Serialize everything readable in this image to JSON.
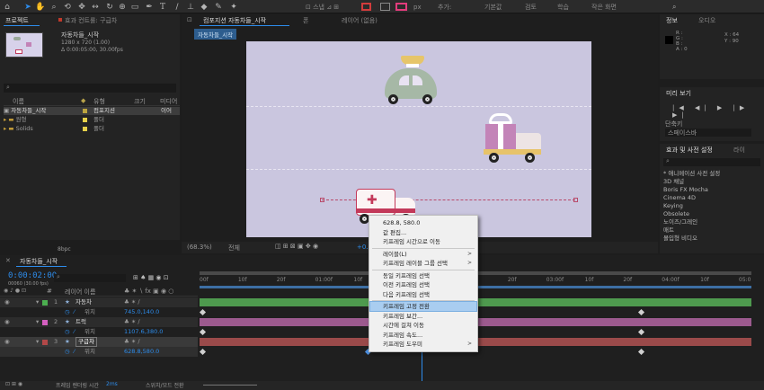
{
  "toolbar": {
    "default_label": "기본값",
    "review_label": "검토",
    "learn_label": "학습",
    "small_screen_label": "작은 화면",
    "add_label": "추가:",
    "fill_label": "칠",
    "px_label": "px"
  },
  "project_panel": {
    "tab_project": "프로젝트",
    "tab_effect_controls": "효과 컨트롤: 구급차",
    "comp_name": "자동차들_시작",
    "comp_size": "1280 x 720 (1.00)",
    "comp_duration": "Δ 0:00:05:00, 30.00fps",
    "col_name": "이름",
    "col_type": "유형",
    "col_size": "크기",
    "col_media": "미디어",
    "items": [
      {
        "name": "자동차들_시작",
        "type": "컴포지션",
        "extra": "이어"
      },
      {
        "name": "원형",
        "type": "폴더",
        "extra": ""
      },
      {
        "name": "Solids",
        "type": "폴더",
        "extra": ""
      }
    ],
    "bpc": "8bpc"
  },
  "comp_panel": {
    "tab_comp": "컴포지션 자동차들_시작",
    "tab_layer": "레이어 (없음)",
    "tab_ext": "폰",
    "breadcrumb": "자동차들_시작",
    "zoom": "(68.3%)",
    "quality": "전체",
    "exposure": "+0.0"
  },
  "info_panel": {
    "tab_info": "정보",
    "tab_audio": "오디오",
    "rgb": [
      "R :",
      "G :",
      "B :",
      "A : 0"
    ],
    "x": "X : 64",
    "y": "Y : 90"
  },
  "preview_panel": {
    "title": "미리 보기",
    "shortcut_label": "단축키",
    "shortcut_value": "스페이스바"
  },
  "effects_panel": {
    "title": "효과 및 사전 설정",
    "tab_lib": "라이",
    "items": [
      "* 애니메이션 사전 설정",
      "3D 채널",
      "Boris FX Mocha",
      "Cinema 4D",
      "Keying",
      "Obsolete",
      "노이즈/그레인",
      "매트",
      "몰입형 비디오"
    ]
  },
  "context_menu": {
    "items": [
      {
        "label": "628.8, 580.0",
        "arrow": ""
      },
      {
        "label": "값 편집...",
        "arrow": ""
      },
      {
        "label": "키프레임 시간으로 이동",
        "arrow": ""
      },
      {
        "label": "레이블(L)",
        "arrow": ">"
      },
      {
        "label": "키프레임 레이블 그룹 선택",
        "arrow": ">"
      },
      {
        "label": "동일 키프레임 선택",
        "arrow": ""
      },
      {
        "label": "이전 키프레임 선택",
        "arrow": ""
      },
      {
        "label": "다음 키프레임 선택",
        "arrow": ""
      },
      {
        "label": "키프레임 고정 전환",
        "arrow": ""
      },
      {
        "label": "키프레임 보간...",
        "arrow": ""
      },
      {
        "label": "시간에 걸쳐 이동",
        "arrow": ""
      },
      {
        "label": "키프레임 속도...",
        "arrow": ""
      },
      {
        "label": "키프레임 도우미",
        "arrow": ">"
      }
    ]
  },
  "timeline": {
    "tab": "자동차들_시작",
    "timecode": "0:00:02:00",
    "timecode_sub": "00060 (30.00 fps)",
    "col_layer_name": "레이어 이름",
    "col_parent": "부모 및 링크",
    "ruler": [
      "00f",
      "10f",
      "20f",
      "01:00f",
      "10f",
      "20f",
      "02:00f",
      "10f",
      "20f",
      "03:00f",
      "10f",
      "20f",
      "04:00f",
      "10f",
      "05:0"
    ],
    "layers": [
      {
        "num": "1",
        "name": "자동차",
        "color": "#4caf50",
        "prop": "위치",
        "value": "745.0,140.0",
        "bar": "#4e9a4e"
      },
      {
        "num": "2",
        "name": "트럭",
        "color": "#d45fc0",
        "prop": "위치",
        "value": "1107.6,380.0",
        "bar": "#9c5a8e"
      },
      {
        "num": "3",
        "name": "구급차",
        "color": "#b24848",
        "prop": "위치",
        "value": "628.8,580.0",
        "bar": "#9a4a4a"
      }
    ],
    "parent_value": "없음",
    "footer_render": "프레임 렌더링 시간",
    "footer_ms": "2ms",
    "footer_toggle": "스위치/모드 전환"
  },
  "colors": {
    "accent": "#2d8ceb",
    "canvas": "#cac6df",
    "highlight": "#a9cdf0"
  }
}
